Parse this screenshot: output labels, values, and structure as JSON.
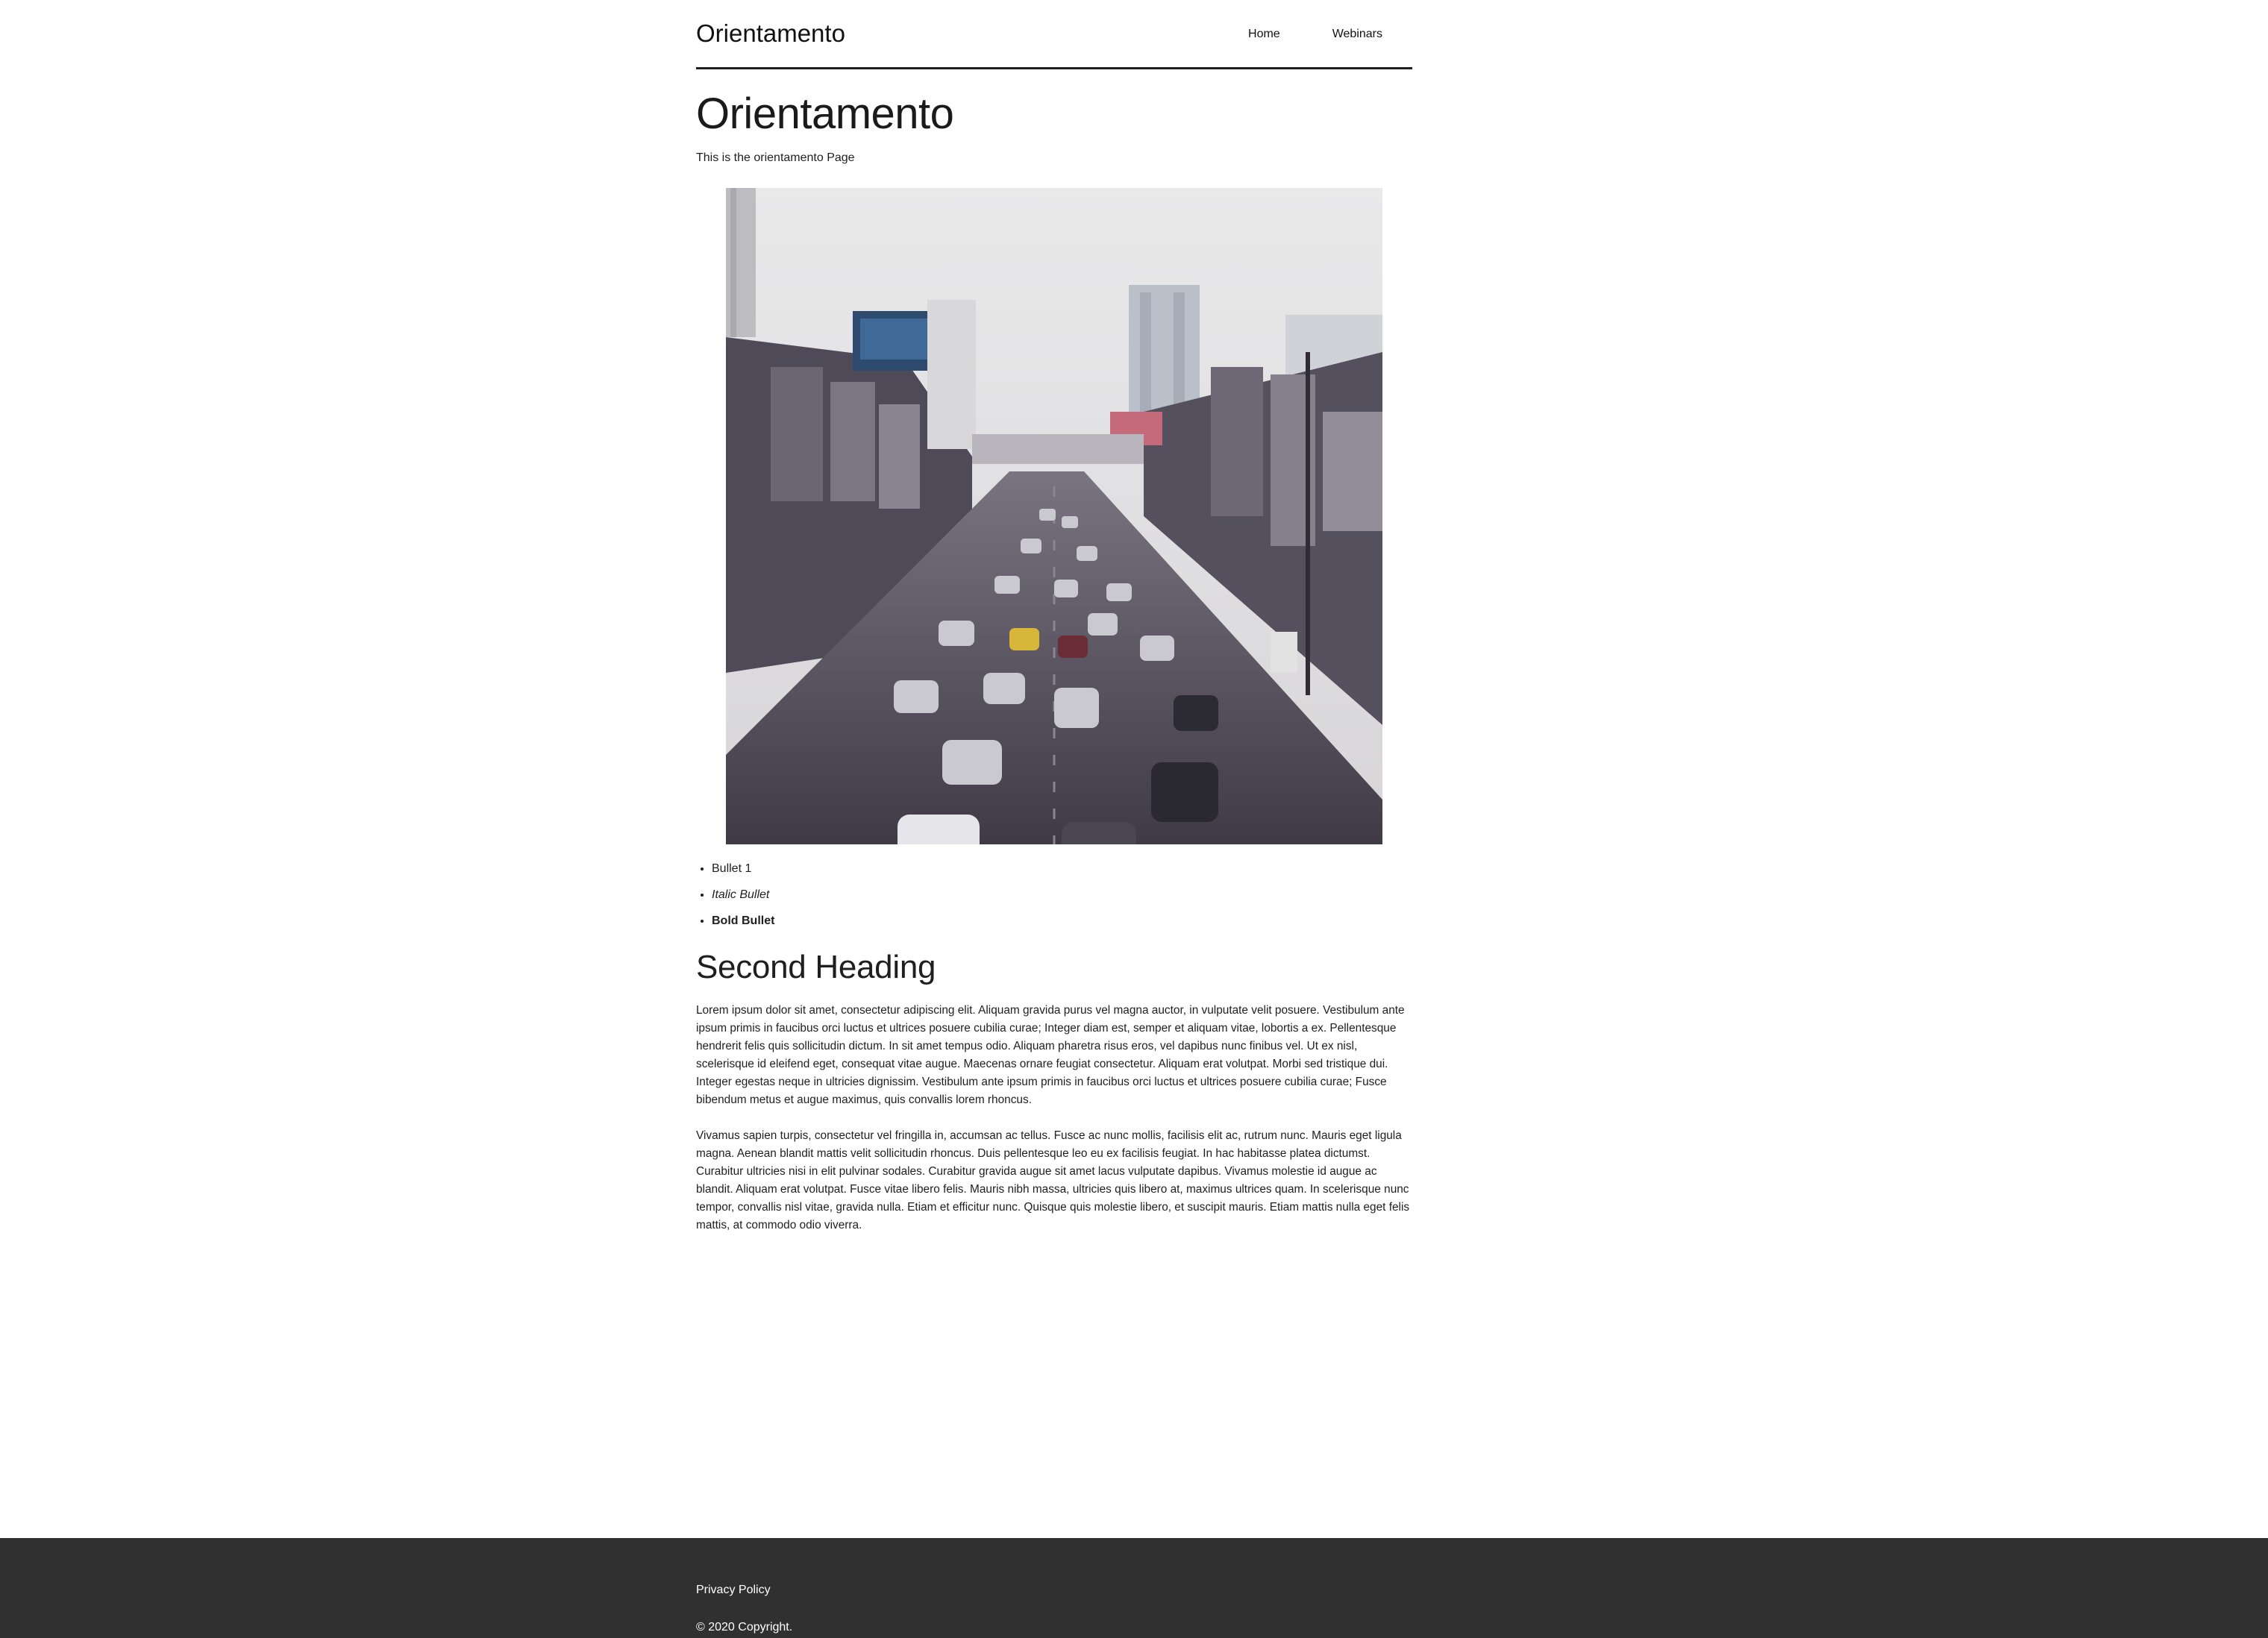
{
  "header": {
    "brand": "Orientamento",
    "nav": [
      {
        "label": "Home"
      },
      {
        "label": "Webinars"
      }
    ]
  },
  "main": {
    "title": "Orientamento",
    "intro": "This is the orientamento Page",
    "image_alt": "street traffic photo",
    "bullets": [
      {
        "label": "Bullet 1",
        "style": "normal"
      },
      {
        "label": "Italic Bullet",
        "style": "italic"
      },
      {
        "label": "Bold Bullet",
        "style": "bold"
      }
    ],
    "second_heading": "Second Heading",
    "paragraphs": [
      "Lorem ipsum dolor sit amet, consectetur adipiscing elit. Aliquam gravida purus vel magna auctor, in vulputate velit posuere. Vestibulum ante ipsum primis in faucibus orci luctus et ultrices posuere cubilia curae; Integer diam est, semper et aliquam vitae, lobortis a ex. Pellentesque hendrerit felis quis sollicitudin dictum. In sit amet tempus odio. Aliquam pharetra risus eros, vel dapibus nunc finibus vel. Ut ex nisl, scelerisque id eleifend eget, consequat vitae augue. Maecenas ornare feugiat consectetur. Aliquam erat volutpat. Morbi sed tristique dui. Integer egestas neque in ultricies dignissim. Vestibulum ante ipsum primis in faucibus orci luctus et ultrices posuere cubilia curae; Fusce bibendum metus et augue maximus, quis convallis lorem rhoncus.",
      "Vivamus sapien turpis, consectetur vel fringilla in, accumsan ac tellus. Fusce ac nunc mollis, facilisis elit ac, rutrum nunc. Mauris eget ligula magna. Aenean blandit mattis velit sollicitudin rhoncus. Duis pellentesque leo eu ex facilisis feugiat. In hac habitasse platea dictumst. Curabitur ultricies nisi in elit pulvinar sodales. Curabitur gravida augue sit amet lacus vulputate dapibus. Vivamus molestie id augue ac blandit. Aliquam erat volutpat. Fusce vitae libero felis. Mauris nibh massa, ultricies quis libero at, maximus ultrices quam. In scelerisque nunc tempor, convallis nisl vitae, gravida nulla. Etiam et efficitur nunc. Quisque quis molestie libero, et suscipit mauris. Etiam mattis nulla eget felis mattis, at commodo odio viverra."
    ]
  },
  "footer": {
    "privacy": "Privacy Policy",
    "copyright": "© 2020 Copyright."
  },
  "colors": {
    "footer_bg": "#303030",
    "text": "#1f1f1f"
  }
}
